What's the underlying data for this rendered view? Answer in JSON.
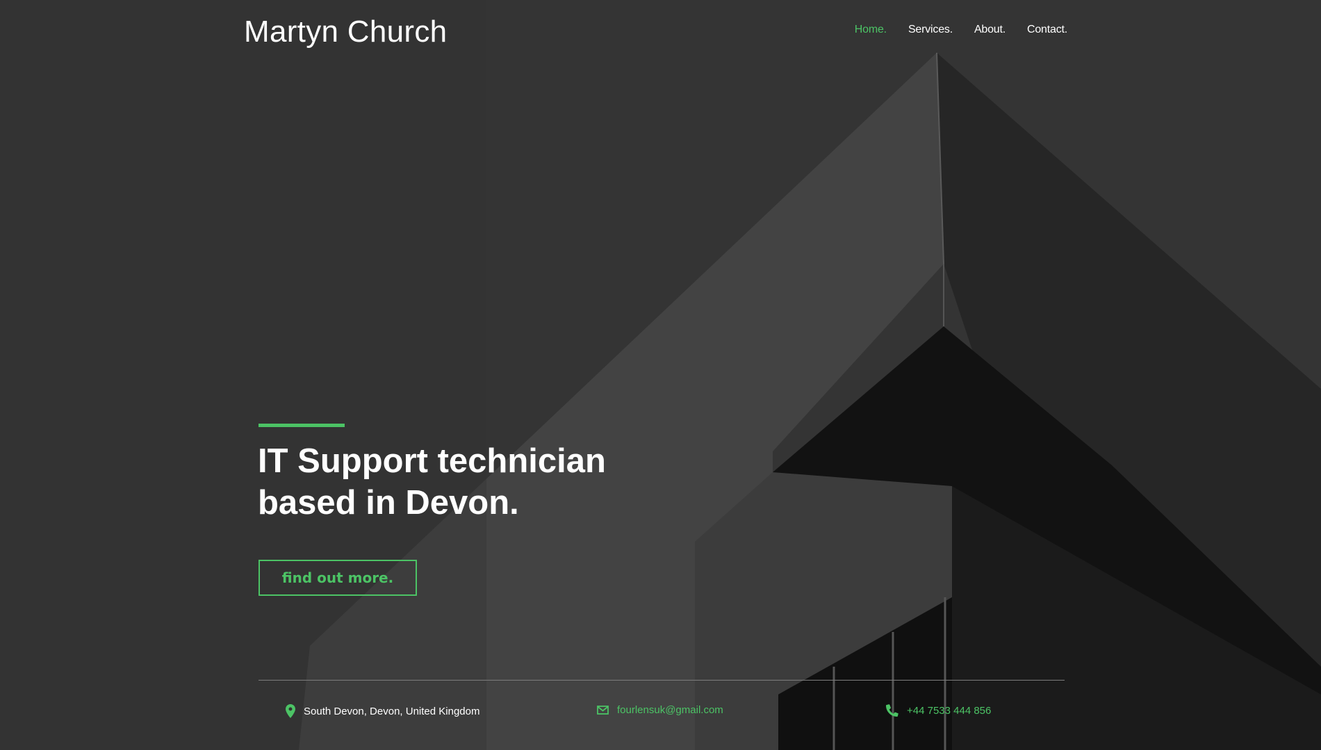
{
  "header": {
    "brand": "Martyn Church"
  },
  "nav": {
    "items": [
      "Home.",
      "Services.",
      "About.",
      "Contact."
    ],
    "active_index": 0
  },
  "hero": {
    "headline_line1": "IT Support technician",
    "headline_line2": "based in Devon.",
    "cta_label": "find out more."
  },
  "contact": {
    "location": "South Devon, Devon, United Kingdom",
    "email": "fourlensuk@gmail.com",
    "phone": "+44 7533 444 856"
  },
  "icons": {
    "location": "map-pin-icon",
    "email": "envelope-icon",
    "phone": "phone-icon"
  },
  "colors": {
    "accent": "#4cc365",
    "background": "#333333",
    "text": "#ffffff"
  }
}
